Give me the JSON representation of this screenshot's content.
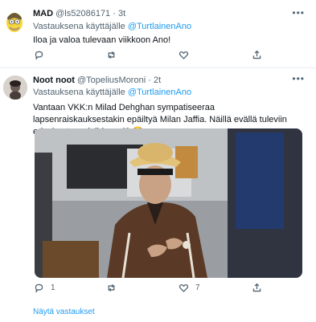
{
  "tweets": [
    {
      "name": "MAD",
      "handle": "@ls52086171",
      "separator": "·",
      "time": "3t",
      "replying_prefix": "Vastauksena käyttäjälle",
      "replying_to": "@TurtlainenAno",
      "text": "Iloa ja valoa tulevaan viikkoon Ano!",
      "more_icon": "ellipsis-icon",
      "actions": {
        "reply": "",
        "retweet": "",
        "like": "",
        "share": ""
      }
    },
    {
      "name": "Noot noot",
      "handle": "@TopeliusMoroni",
      "separator": "·",
      "time": "2t",
      "replying_prefix": "Vastauksena käyttäjälle",
      "replying_to": "@TurtlainenAno",
      "text": "Vantaan VKK:n Milad Dehghan sympatiseeraa lapsenraiskauksestakin epäiltyä Milan Jaffia. Näillä evällä tuleviin eduskuntavaaleihin, vai? 🤓",
      "more_icon": "ellipsis-icon",
      "actions": {
        "reply": "1",
        "retweet": "",
        "like": "7",
        "share": ""
      }
    }
  ],
  "show_replies": "Näytä vastaukset",
  "colors": {
    "link": "#1d9bf0",
    "secondary_text": "#536471",
    "divider": "#e6ecf0"
  }
}
